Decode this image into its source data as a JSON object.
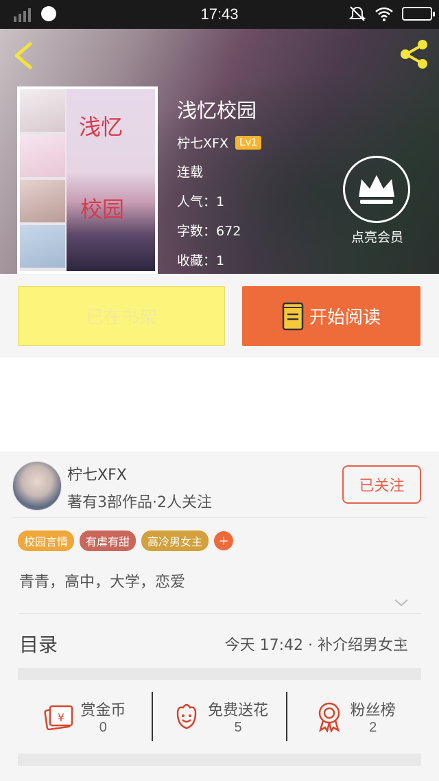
{
  "status_bar": {
    "time": "17:43"
  },
  "book": {
    "title": "浅忆校园",
    "author": "柠七XFX",
    "level": "Lv1",
    "status": "连载",
    "popularity_label": "人气：",
    "popularity": "1",
    "wordcount_label": "字数：",
    "wordcount": "672",
    "favorites_label": "收藏：",
    "favorites": "1",
    "cover_text_1": "浅忆",
    "cover_text_2": "校园"
  },
  "vip": {
    "label": "点亮会员"
  },
  "actions": {
    "shelf_label": "已在书架",
    "read_label": "开始阅读"
  },
  "author": {
    "name": "柠七XFX",
    "stats": "著有3部作品·2人关注",
    "follow_label": "已关注"
  },
  "tags": [
    {
      "label": "校园言情",
      "color": "#f0a73a"
    },
    {
      "label": "有虐有甜",
      "color": "#c9675a"
    },
    {
      "label": "高冷男女主",
      "color": "#d2a03c"
    }
  ],
  "tag_more": "+",
  "intro": "青青，高中，大学，恋爱",
  "toc": {
    "title": "目录",
    "update": "今天 17:42 · 补介绍男女主"
  },
  "stats": [
    {
      "label": "赏金币",
      "value": "0",
      "icon": "reward-coin-icon"
    },
    {
      "label": "免费送花",
      "value": "5",
      "icon": "flower-icon"
    },
    {
      "label": "粉丝榜",
      "value": "2",
      "icon": "ribbon-medal-icon"
    }
  ],
  "colors": {
    "accent": "#ee6b3a",
    "shelf": "#fbf57b",
    "follow": "#e9614a",
    "icon_red": "#d8452c"
  }
}
